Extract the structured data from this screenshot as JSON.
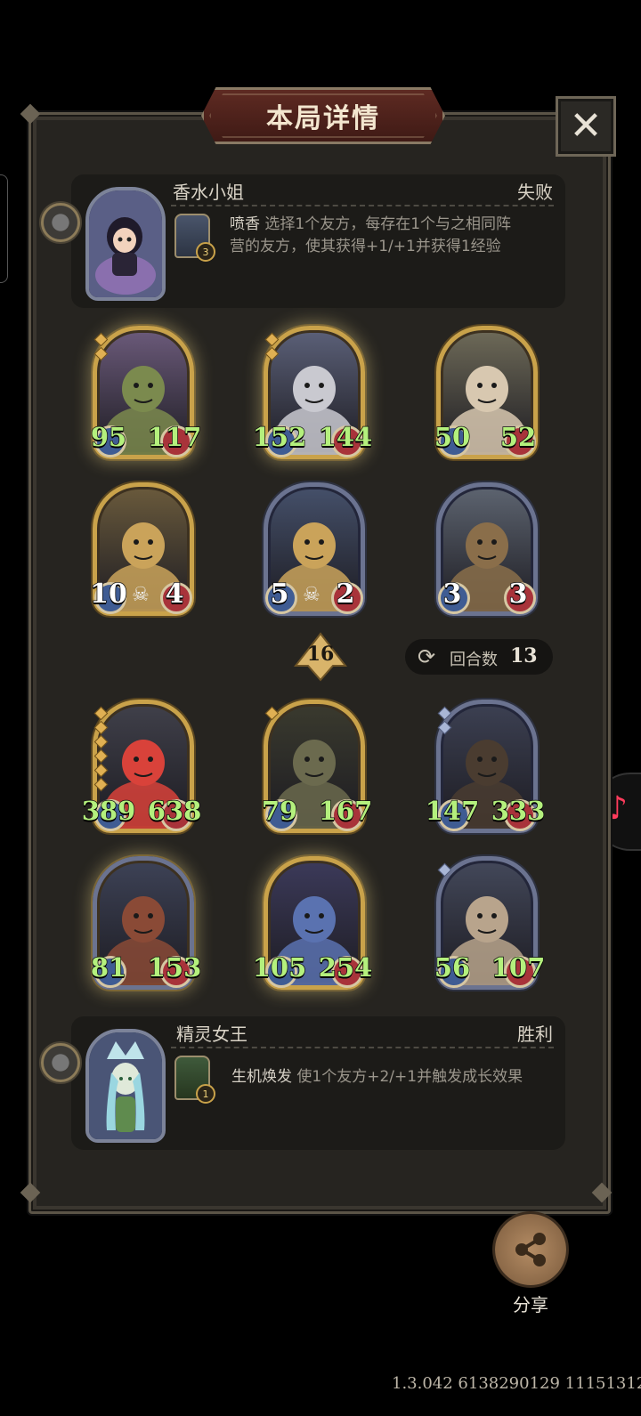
{
  "title": "本局详情",
  "close_icon": "✕",
  "top_player": {
    "name": "香水小姐",
    "result": "失败",
    "ability_name": "喷香",
    "ability_desc_line1": "选择1个友方，每存在1个与之相同阵",
    "ability_desc_line2": "营的友方，使其获得+1/+1并获得1经验",
    "ability_level": "3"
  },
  "top_board": [
    {
      "attack": "95",
      "health": "117",
      "frame": "gold",
      "glow": true,
      "tiers": 2
    },
    {
      "attack": "152",
      "health": "144",
      "frame": "gold",
      "glow": true,
      "tiers": 2
    },
    {
      "attack": "50",
      "health": "52",
      "frame": "gold",
      "glow": false,
      "tiers": 0
    },
    {
      "attack": "10",
      "health": "4",
      "frame": "gold",
      "glow": false,
      "tiers": 0
    },
    {
      "attack": "5",
      "health": "2",
      "frame": "silver",
      "glow": false,
      "tiers": 0
    },
    {
      "attack": "3",
      "health": "3",
      "frame": "silver",
      "glow": false,
      "tiers": 0
    }
  ],
  "turn_marker": "16",
  "rounds_label": "回合数",
  "rounds_value": "13",
  "bottom_board": [
    {
      "attack": "389",
      "health": "638",
      "frame": "gold",
      "glow": false,
      "tiers": 6
    },
    {
      "attack": "79",
      "health": "167",
      "frame": "gold",
      "glow": false,
      "tiers": 1
    },
    {
      "attack": "147",
      "health": "333",
      "frame": "silver",
      "glow": false,
      "tiers": 2
    },
    {
      "attack": "81",
      "health": "153",
      "frame": "silver",
      "glow": true,
      "tiers": 0
    },
    {
      "attack": "105",
      "health": "254",
      "frame": "gold",
      "glow": true,
      "tiers": 0
    },
    {
      "attack": "56",
      "health": "107",
      "frame": "silver",
      "glow": false,
      "tiers": 1
    }
  ],
  "bottom_player": {
    "name": "精灵女王",
    "result": "胜利",
    "ability_name": "生机焕发",
    "ability_desc": "使1个友方+2/+1并触发成长效果",
    "ability_level": "1"
  },
  "share_label": "分享",
  "version": "1.3.042 6138290129 11151312",
  "colors": {
    "accent_gold": "#c9a24a",
    "stat_green": "#b4f07d",
    "banner_red": "#5e2a22"
  }
}
